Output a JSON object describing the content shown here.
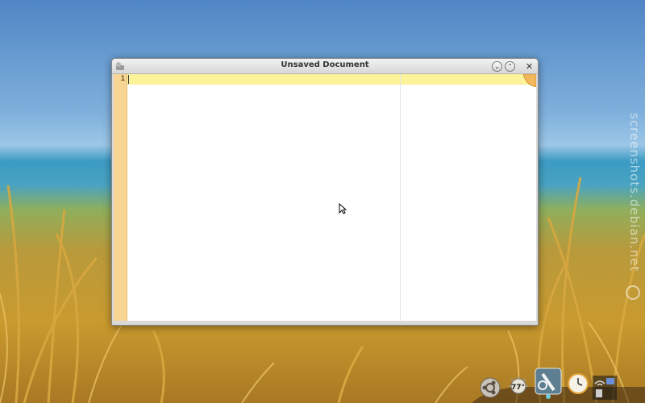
{
  "window": {
    "title": "Unsaved Document",
    "minimize_icon": "chevron-down-icon",
    "maximize_icon": "chevron-up-icon",
    "close_icon": "close-icon",
    "min_glyph": "⌄",
    "max_glyph": "⌃",
    "close_glyph": "✕"
  },
  "editor": {
    "line_numbers": [
      "1"
    ],
    "content": "",
    "current_line_color": "#fbf29a",
    "gutter_color": "#f9d594"
  },
  "dock": {
    "items": [
      {
        "icon": "ubuntu-logo-icon"
      },
      {
        "icon": "weather-icon",
        "label": "77°"
      },
      {
        "icon": "pen-tool-icon"
      },
      {
        "icon": "clock-icon"
      },
      {
        "icon": "system-tray-icon"
      }
    ]
  },
  "watermark": "screenshots.debian.net"
}
